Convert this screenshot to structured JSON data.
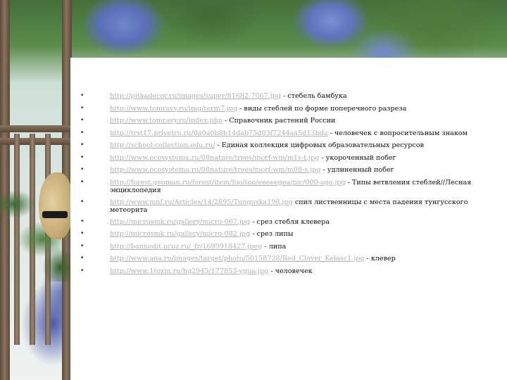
{
  "slide": {
    "bullet_glyph": "•",
    "items": [
      {
        "url": "http://pitkadecor.ru/images/super/81682-7067.jpg",
        "desc": " - стебель бамбука"
      },
      {
        "url": "http://www.tomravy.ru/img/term7.jpg",
        "desc": " - виды стеблей по форме поперечного разреза"
      },
      {
        "url": "http://www.tomravy.ru/index.php",
        "desc": " - Справочник растений России"
      },
      {
        "url": "http://trst17.privetru.ru/0a0a0b8b14dab75d03f7244aa5d13bda",
        "desc": " - человечек с вопросительным знаком"
      },
      {
        "url": "http://school-collection.edu.ru/",
        "desc": " - Единая коллекция цифровых образовательных ресурсов"
      },
      {
        "url": "http://www.ecosystema.ru/08nature/trees/morf-wm/m1s-t.jpg",
        "desc": " - укороченный побег"
      },
      {
        "url": "http://www.ecosystema.ru/08nature/trees/morf-wm/m08-s.jpg",
        "desc": " - удлиненный побег"
      },
      {
        "url": "http://forest.geoman.ru/forest/item/foo/too/eeeeegea/pic/000-ago.jpg",
        "desc": " - Типы ветвления стеблей//Лесная энциклопедия"
      },
      {
        "url": "http://www.mnf.ru/Articles/14/2895/Tunguska198.jpg",
        "desc": " спил лиственницы с места падения тунгусского метеорита"
      },
      {
        "url": "http://microsmk.ru/gallery/micro-067.jpg",
        "desc": " - срез стебля клевера"
      },
      {
        "url": "http://microsmk.ru/gallery/micro-082.jpg",
        "desc": " - срез липы"
      },
      {
        "url": "http://bannedit.ucoz.ru/_fr/1699918427.jpeg",
        "desc": " - липа"
      },
      {
        "url": "http://www.ana.ru/images/target/photo/50158728/Red_Clover_Kelasc1.jpg",
        "desc": " - клевер"
      },
      {
        "url": "http://www.1toxin.ru/hg2945/177853-ygua.jpg",
        "desc": " - человечек"
      }
    ]
  }
}
